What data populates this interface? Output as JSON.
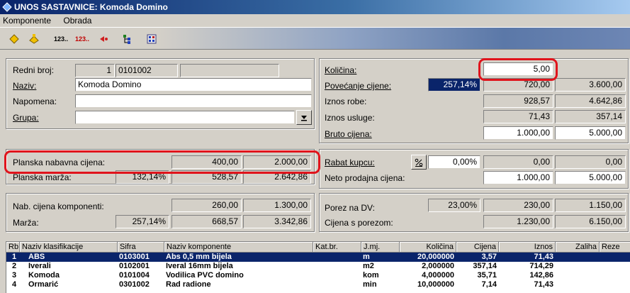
{
  "window": {
    "title": "UNOS SASTAVNICE: Komoda Domino"
  },
  "menu": {
    "items": [
      "Komponente",
      "Obrada"
    ]
  },
  "toolbar": {
    "btn_a": "123..",
    "btn_b": "123.."
  },
  "header": {
    "redni_broj_label": "Redni broj:",
    "redni_broj_value": "1",
    "redni_broj_code": "0101002",
    "naziv_label": "Naziv:",
    "naziv_value": "Komoda Domino",
    "napomena_label": "Napomena:",
    "napomena_value": "",
    "grupa_label": "Grupa:",
    "grupa_value": ""
  },
  "planska": {
    "nabavna_label": "Planska nabavna cijena:",
    "nabavna_v1": "400,00",
    "nabavna_v2": "2.000,00",
    "marza_label": "Planska marža:",
    "marza_pct": "132,14%",
    "marza_v1": "528,57",
    "marza_v2": "2.642,86"
  },
  "komponente": {
    "nab_label": "Nab. cijena komponenti:",
    "nab_v1": "260,00",
    "nab_v2": "1.300,00",
    "marza_label": "Marža:",
    "marza_pct": "257,14%",
    "marza_v1": "668,57",
    "marza_v2": "3.342,86"
  },
  "right": {
    "kolicina_label": "Količina:",
    "kolicina_value": "5,00",
    "povecanje_label": "Povećanje cijene:",
    "povecanje_pct": "257,14%",
    "povecanje_v1": "720,00",
    "povecanje_v2": "3.600,00",
    "iznos_robe_label": "Iznos robe:",
    "iznos_robe_v1": "928,57",
    "iznos_robe_v2": "4.642,86",
    "iznos_usluge_label": "Iznos usluge:",
    "iznos_usluge_v1": "71,43",
    "iznos_usluge_v2": "357,14",
    "bruto_label": "Bruto cijena:",
    "bruto_v1": "1.000,00",
    "bruto_v2": "5.000,00"
  },
  "rabat": {
    "rabat_label": "Rabat kupcu:",
    "rabat_pct": "0,00%",
    "rabat_v1": "0,00",
    "rabat_v2": "0,00",
    "neto_label": "Neto prodajna cijena:",
    "neto_v1": "1.000,00",
    "neto_v2": "5.000,00"
  },
  "porez": {
    "porez_label": "Porez na DV:",
    "porez_pct": "23,00%",
    "porez_v1": "230,00",
    "porez_v2": "1.150,00",
    "sporezom_label": "Cijena s porezom:",
    "sporezom_v1": "1.230,00",
    "sporezom_v2": "6.150,00"
  },
  "table": {
    "columns": [
      "Rb.",
      "Naziv klasifikacije",
      "Sifra",
      "Naziv komponente",
      "Kat.br.",
      "J.mj.",
      "Količina",
      "Cijena",
      "Iznos",
      "Zaliha",
      "Reze"
    ],
    "rows": [
      {
        "rb": "1",
        "klas": "ABS",
        "sifra": "0103001",
        "naziv": "Abs 0,5 mm  bijela",
        "katbr": "",
        "jmj": "m",
        "kolicina": "20,000000",
        "cijena": "3,57",
        "iznos": "71,43"
      },
      {
        "rb": "2",
        "klas": "Iverali",
        "sifra": "0102001",
        "naziv": "Iveral 16mm  bijela",
        "katbr": "",
        "jmj": "m2",
        "kolicina": "2,000000",
        "cijena": "357,14",
        "iznos": "714,29"
      },
      {
        "rb": "3",
        "klas": "Komoda",
        "sifra": "0101004",
        "naziv": "Vodilica PVC domino",
        "katbr": "",
        "jmj": "kom",
        "kolicina": "4,000000",
        "cijena": "35,71",
        "iznos": "142,86"
      },
      {
        "rb": "4",
        "klas": "Ormarić",
        "sifra": "0301002",
        "naziv": "Rad radione",
        "katbr": "",
        "jmj": "min",
        "kolicina": "10,000000",
        "cijena": "7,14",
        "iznos": "71,43"
      }
    ]
  }
}
